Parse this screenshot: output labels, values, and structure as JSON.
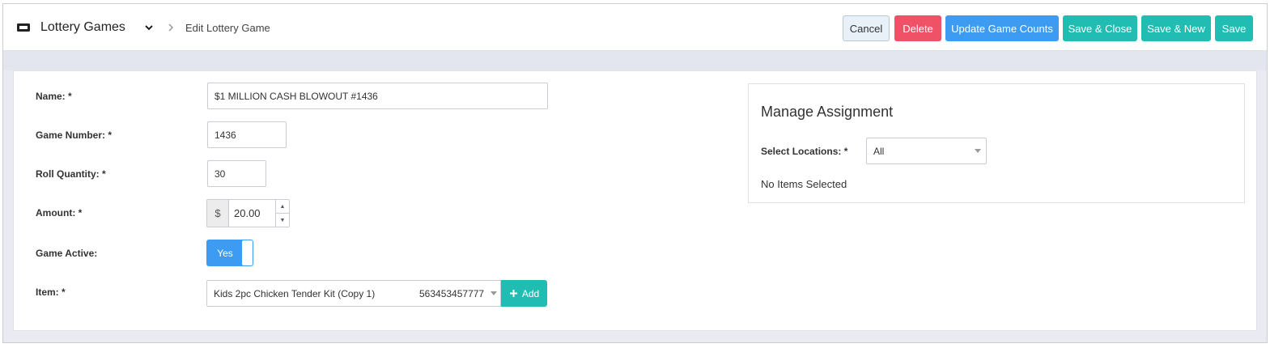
{
  "header": {
    "module_title": "Lottery Games",
    "page_subtitle": "Edit Lottery Game"
  },
  "toolbar": {
    "cancel_label": "Cancel",
    "delete_label": "Delete",
    "update_counts_label": "Update Game Counts",
    "save_close_label": "Save & Close",
    "save_new_label": "Save & New",
    "save_label": "Save"
  },
  "form": {
    "name_label": "Name: *",
    "name_value": "$1 MILLION CASH BLOWOUT #1436",
    "game_number_label": "Game Number: *",
    "game_number_value": "1436",
    "roll_quantity_label": "Roll Quantity: *",
    "roll_quantity_value": "30",
    "amount_label": "Amount: *",
    "amount_prefix": "$",
    "amount_value": "20.00",
    "game_active_label": "Game Active:",
    "game_active_value": "Yes",
    "item_label": "Item: *",
    "item_name": "Kids 2pc Chicken Tender Kit (Copy 1)",
    "item_code": "563453457777",
    "add_label": "Add"
  },
  "assignment": {
    "title": "Manage Assignment",
    "locations_label": "Select Locations: *",
    "locations_value": "All",
    "empty_text": "No Items Selected"
  },
  "colors": {
    "primary_blue": "#3d9cf1",
    "teal": "#21bdb2",
    "danger": "#ef5266"
  },
  "icons": [
    "ticket-icon",
    "chevron-down-icon",
    "chevron-right-icon",
    "plus-icon",
    "caret-down-icon",
    "spin-up-icon",
    "spin-down-icon"
  ]
}
